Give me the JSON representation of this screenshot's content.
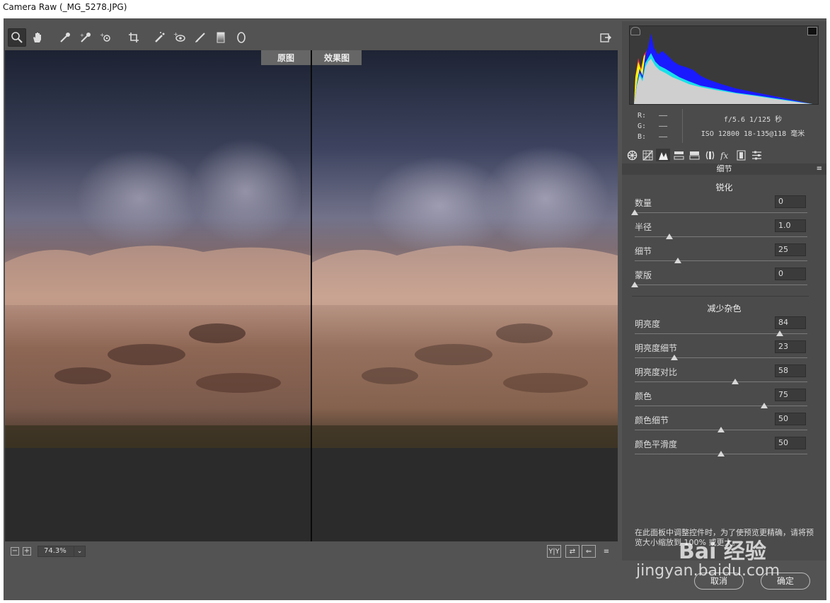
{
  "window": {
    "title": "Camera Raw (_MG_5278.JPG)"
  },
  "toolbar": {
    "tools": [
      {
        "name": "zoom-tool-icon",
        "active": true
      },
      {
        "name": "hand-tool-icon"
      },
      {
        "name": "white-balance-eyedropper-icon"
      },
      {
        "name": "color-sampler-icon"
      },
      {
        "name": "targeted-adjustment-icon"
      },
      {
        "name": "crop-tool-icon"
      },
      {
        "name": "spot-removal-icon"
      },
      {
        "name": "red-eye-removal-icon"
      },
      {
        "name": "adjustment-brush-icon"
      },
      {
        "name": "graduated-filter-icon"
      },
      {
        "name": "radial-filter-icon"
      }
    ],
    "open_preferences_icon": "open-in-photoshop-icon"
  },
  "preview": {
    "before_label": "原图",
    "after_label": "效果图"
  },
  "bottombar": {
    "zoom_out": "−",
    "zoom_in": "+",
    "zoom_value": "74.3%",
    "zoom_arrow": "⌄",
    "view_icons": [
      "Y|Y",
      "⇄",
      "⇐",
      "≡"
    ]
  },
  "readout": {
    "r_label": "R:",
    "r_value": "——",
    "g_label": "G:",
    "g_value": "——",
    "b_label": "B:",
    "b_value": "——",
    "aperture_shutter": "f/5.6  1/125 秒",
    "iso_lens": "ISO 12800  18-135@118 毫米"
  },
  "panel": {
    "title": "细节",
    "menu_icon": "≡",
    "sharpening": {
      "title": "锐化",
      "sliders": [
        {
          "label": "数量",
          "value": "0",
          "pos": 0.0
        },
        {
          "label": "半径",
          "value": "1.0",
          "pos": 0.2
        },
        {
          "label": "细节",
          "value": "25",
          "pos": 0.25
        },
        {
          "label": "蒙版",
          "value": "0",
          "pos": 0.0
        }
      ]
    },
    "noise_reduction": {
      "title": "减少杂色",
      "sliders": [
        {
          "label": "明亮度",
          "value": "84",
          "pos": 0.84
        },
        {
          "label": "明亮度细节",
          "value": "23",
          "pos": 0.23
        },
        {
          "label": "明亮度对比",
          "value": "58",
          "pos": 0.58
        },
        {
          "label": "颜色",
          "value": "75",
          "pos": 0.75
        },
        {
          "label": "颜色细节",
          "value": "50",
          "pos": 0.5
        },
        {
          "label": "颜色平滑度",
          "value": "50",
          "pos": 0.5
        }
      ]
    },
    "note": "在此面板中调整控件时，为了使预览更精确，请将预览大小缩放到 100% 或更大。"
  },
  "footer": {
    "cancel": "取消",
    "ok": "确定"
  },
  "watermark": {
    "brand": "Bai 经验",
    "url": "jingyan.baidu.com"
  }
}
